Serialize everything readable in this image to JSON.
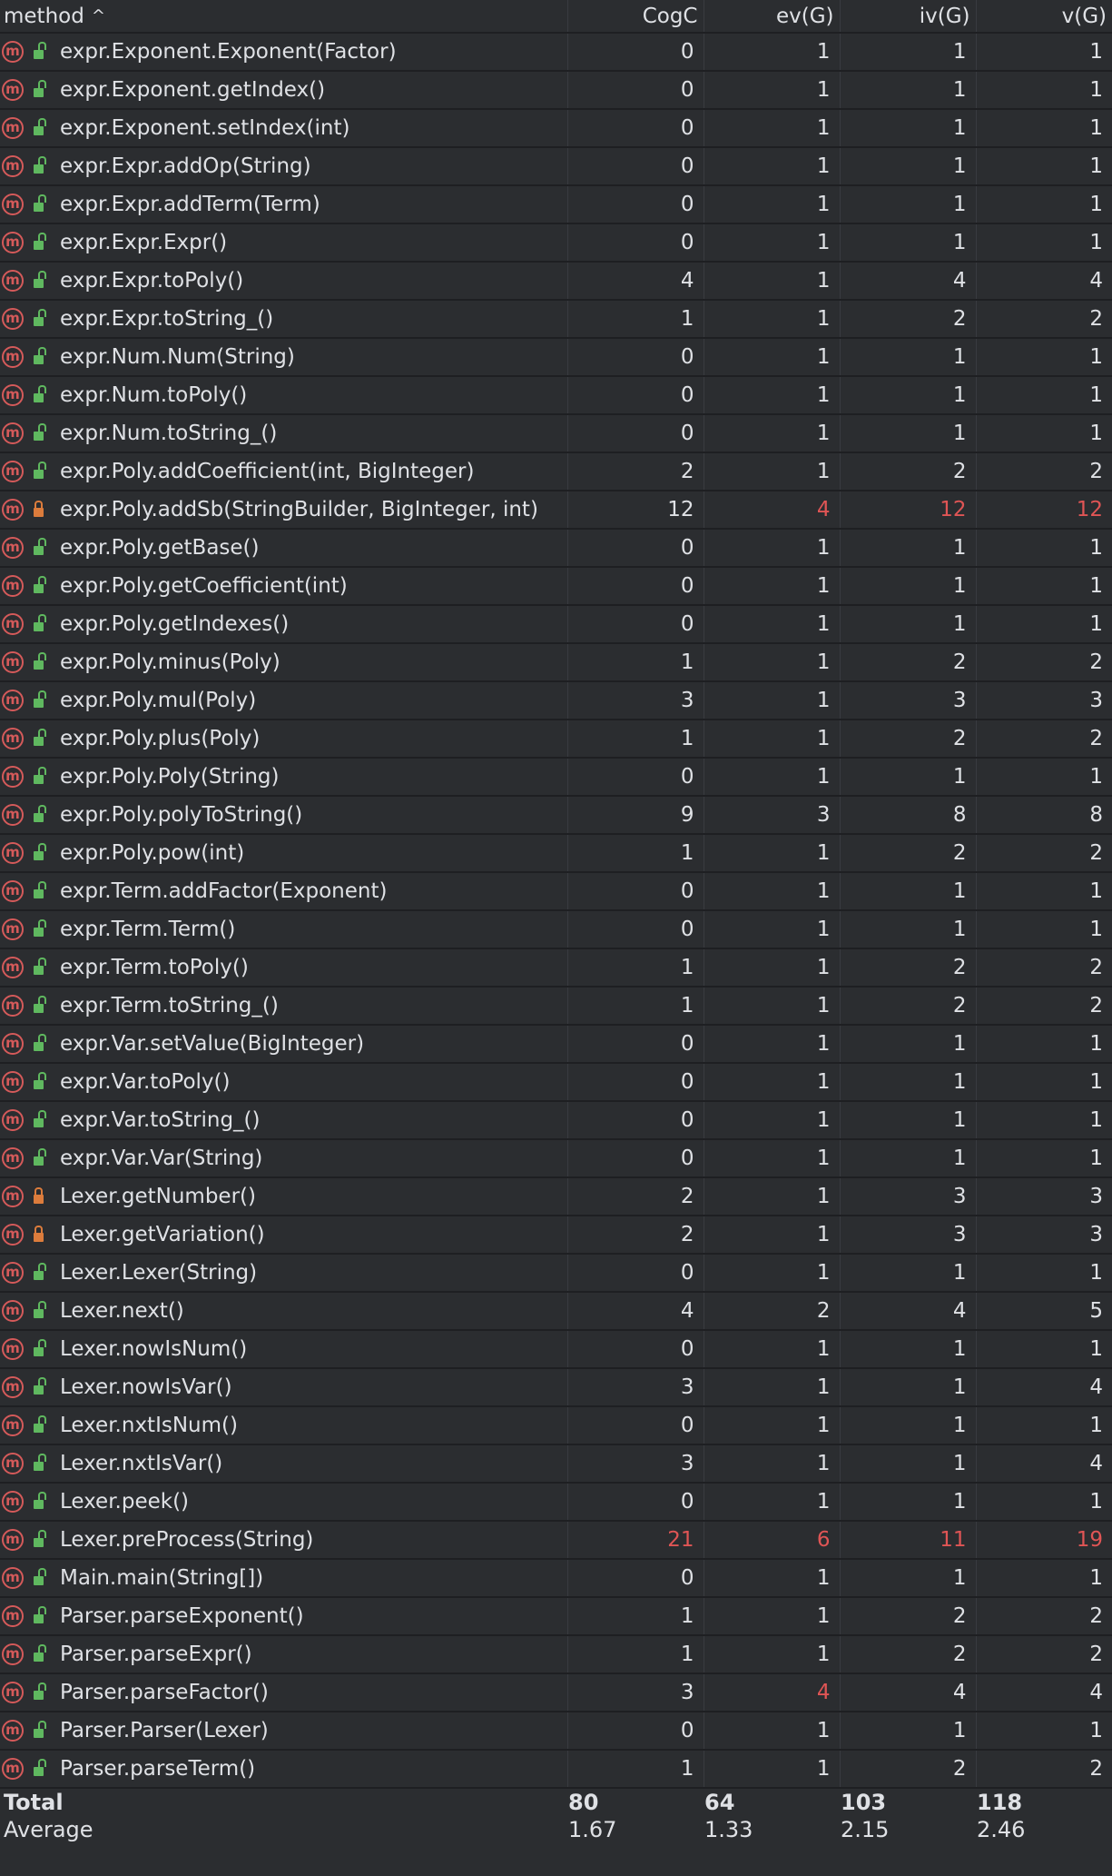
{
  "columns": [
    "method",
    "CogC",
    "ev(G)",
    "iv(G)",
    "v(G)"
  ],
  "sort": {
    "column": "method",
    "direction": "ascending",
    "indicator": "^"
  },
  "method_icon_letter": "m",
  "colors": {
    "background": "#2b2d30",
    "text": "#dfe1e5",
    "threshold_exceeded": "#e05555",
    "method_icon": "#d55a5a",
    "public_lock": "#5fb85f",
    "private_lock": "#dc7c3c"
  },
  "rows": [
    {
      "method": "expr.Exponent.Exponent(Factor)",
      "access": "public",
      "cogc": "0",
      "ev": "1",
      "iv": "1",
      "v": "1",
      "red": []
    },
    {
      "method": "expr.Exponent.getIndex()",
      "access": "public",
      "cogc": "0",
      "ev": "1",
      "iv": "1",
      "v": "1",
      "red": []
    },
    {
      "method": "expr.Exponent.setIndex(int)",
      "access": "public",
      "cogc": "0",
      "ev": "1",
      "iv": "1",
      "v": "1",
      "red": []
    },
    {
      "method": "expr.Expr.addOp(String)",
      "access": "public",
      "cogc": "0",
      "ev": "1",
      "iv": "1",
      "v": "1",
      "red": []
    },
    {
      "method": "expr.Expr.addTerm(Term)",
      "access": "public",
      "cogc": "0",
      "ev": "1",
      "iv": "1",
      "v": "1",
      "red": []
    },
    {
      "method": "expr.Expr.Expr()",
      "access": "public",
      "cogc": "0",
      "ev": "1",
      "iv": "1",
      "v": "1",
      "red": []
    },
    {
      "method": "expr.Expr.toPoly()",
      "access": "public",
      "cogc": "4",
      "ev": "1",
      "iv": "4",
      "v": "4",
      "red": []
    },
    {
      "method": "expr.Expr.toString_()",
      "access": "public",
      "cogc": "1",
      "ev": "1",
      "iv": "2",
      "v": "2",
      "red": []
    },
    {
      "method": "expr.Num.Num(String)",
      "access": "public",
      "cogc": "0",
      "ev": "1",
      "iv": "1",
      "v": "1",
      "red": []
    },
    {
      "method": "expr.Num.toPoly()",
      "access": "public",
      "cogc": "0",
      "ev": "1",
      "iv": "1",
      "v": "1",
      "red": []
    },
    {
      "method": "expr.Num.toString_()",
      "access": "public",
      "cogc": "0",
      "ev": "1",
      "iv": "1",
      "v": "1",
      "red": []
    },
    {
      "method": "expr.Poly.addCoefficient(int, BigInteger)",
      "access": "public",
      "cogc": "2",
      "ev": "1",
      "iv": "2",
      "v": "2",
      "red": []
    },
    {
      "method": "expr.Poly.addSb(StringBuilder, BigInteger, int)",
      "access": "private",
      "cogc": "12",
      "ev": "4",
      "iv": "12",
      "v": "12",
      "red": [
        "ev",
        "iv",
        "v"
      ]
    },
    {
      "method": "expr.Poly.getBase()",
      "access": "public",
      "cogc": "0",
      "ev": "1",
      "iv": "1",
      "v": "1",
      "red": []
    },
    {
      "method": "expr.Poly.getCoefficient(int)",
      "access": "public",
      "cogc": "0",
      "ev": "1",
      "iv": "1",
      "v": "1",
      "red": []
    },
    {
      "method": "expr.Poly.getIndexes()",
      "access": "public",
      "cogc": "0",
      "ev": "1",
      "iv": "1",
      "v": "1",
      "red": []
    },
    {
      "method": "expr.Poly.minus(Poly)",
      "access": "public",
      "cogc": "1",
      "ev": "1",
      "iv": "2",
      "v": "2",
      "red": []
    },
    {
      "method": "expr.Poly.mul(Poly)",
      "access": "public",
      "cogc": "3",
      "ev": "1",
      "iv": "3",
      "v": "3",
      "red": []
    },
    {
      "method": "expr.Poly.plus(Poly)",
      "access": "public",
      "cogc": "1",
      "ev": "1",
      "iv": "2",
      "v": "2",
      "red": []
    },
    {
      "method": "expr.Poly.Poly(String)",
      "access": "public",
      "cogc": "0",
      "ev": "1",
      "iv": "1",
      "v": "1",
      "red": []
    },
    {
      "method": "expr.Poly.polyToString()",
      "access": "public",
      "cogc": "9",
      "ev": "3",
      "iv": "8",
      "v": "8",
      "red": []
    },
    {
      "method": "expr.Poly.pow(int)",
      "access": "public",
      "cogc": "1",
      "ev": "1",
      "iv": "2",
      "v": "2",
      "red": []
    },
    {
      "method": "expr.Term.addFactor(Exponent)",
      "access": "public",
      "cogc": "0",
      "ev": "1",
      "iv": "1",
      "v": "1",
      "red": []
    },
    {
      "method": "expr.Term.Term()",
      "access": "public",
      "cogc": "0",
      "ev": "1",
      "iv": "1",
      "v": "1",
      "red": []
    },
    {
      "method": "expr.Term.toPoly()",
      "access": "public",
      "cogc": "1",
      "ev": "1",
      "iv": "2",
      "v": "2",
      "red": []
    },
    {
      "method": "expr.Term.toString_()",
      "access": "public",
      "cogc": "1",
      "ev": "1",
      "iv": "2",
      "v": "2",
      "red": []
    },
    {
      "method": "expr.Var.setValue(BigInteger)",
      "access": "public",
      "cogc": "0",
      "ev": "1",
      "iv": "1",
      "v": "1",
      "red": []
    },
    {
      "method": "expr.Var.toPoly()",
      "access": "public",
      "cogc": "0",
      "ev": "1",
      "iv": "1",
      "v": "1",
      "red": []
    },
    {
      "method": "expr.Var.toString_()",
      "access": "public",
      "cogc": "0",
      "ev": "1",
      "iv": "1",
      "v": "1",
      "red": []
    },
    {
      "method": "expr.Var.Var(String)",
      "access": "public",
      "cogc": "0",
      "ev": "1",
      "iv": "1",
      "v": "1",
      "red": []
    },
    {
      "method": "Lexer.getNumber()",
      "access": "private",
      "cogc": "2",
      "ev": "1",
      "iv": "3",
      "v": "3",
      "red": []
    },
    {
      "method": "Lexer.getVariation()",
      "access": "private",
      "cogc": "2",
      "ev": "1",
      "iv": "3",
      "v": "3",
      "red": []
    },
    {
      "method": "Lexer.Lexer(String)",
      "access": "public",
      "cogc": "0",
      "ev": "1",
      "iv": "1",
      "v": "1",
      "red": []
    },
    {
      "method": "Lexer.next()",
      "access": "public",
      "cogc": "4",
      "ev": "2",
      "iv": "4",
      "v": "5",
      "red": []
    },
    {
      "method": "Lexer.nowIsNum()",
      "access": "public",
      "cogc": "0",
      "ev": "1",
      "iv": "1",
      "v": "1",
      "red": []
    },
    {
      "method": "Lexer.nowIsVar()",
      "access": "public",
      "cogc": "3",
      "ev": "1",
      "iv": "1",
      "v": "4",
      "red": []
    },
    {
      "method": "Lexer.nxtIsNum()",
      "access": "public",
      "cogc": "0",
      "ev": "1",
      "iv": "1",
      "v": "1",
      "red": []
    },
    {
      "method": "Lexer.nxtIsVar()",
      "access": "public",
      "cogc": "3",
      "ev": "1",
      "iv": "1",
      "v": "4",
      "red": []
    },
    {
      "method": "Lexer.peek()",
      "access": "public",
      "cogc": "0",
      "ev": "1",
      "iv": "1",
      "v": "1",
      "red": []
    },
    {
      "method": "Lexer.preProcess(String)",
      "access": "public",
      "cogc": "21",
      "ev": "6",
      "iv": "11",
      "v": "19",
      "red": [
        "cogc",
        "ev",
        "iv",
        "v"
      ]
    },
    {
      "method": "Main.main(String[])",
      "access": "public",
      "cogc": "0",
      "ev": "1",
      "iv": "1",
      "v": "1",
      "red": []
    },
    {
      "method": "Parser.parseExponent()",
      "access": "public",
      "cogc": "1",
      "ev": "1",
      "iv": "2",
      "v": "2",
      "red": []
    },
    {
      "method": "Parser.parseExpr()",
      "access": "public",
      "cogc": "1",
      "ev": "1",
      "iv": "2",
      "v": "2",
      "red": []
    },
    {
      "method": "Parser.parseFactor()",
      "access": "public",
      "cogc": "3",
      "ev": "4",
      "iv": "4",
      "v": "4",
      "red": [
        "ev"
      ]
    },
    {
      "method": "Parser.Parser(Lexer)",
      "access": "public",
      "cogc": "0",
      "ev": "1",
      "iv": "1",
      "v": "1",
      "red": []
    },
    {
      "method": "Parser.parseTerm()",
      "access": "public",
      "cogc": "1",
      "ev": "1",
      "iv": "2",
      "v": "2",
      "red": []
    }
  ],
  "total": {
    "label": "Total",
    "cogc": "80",
    "ev": "64",
    "iv": "103",
    "v": "118"
  },
  "average": {
    "label": "Average",
    "cogc": "1.67",
    "ev": "1.33",
    "iv": "2.15",
    "v": "2.46"
  }
}
